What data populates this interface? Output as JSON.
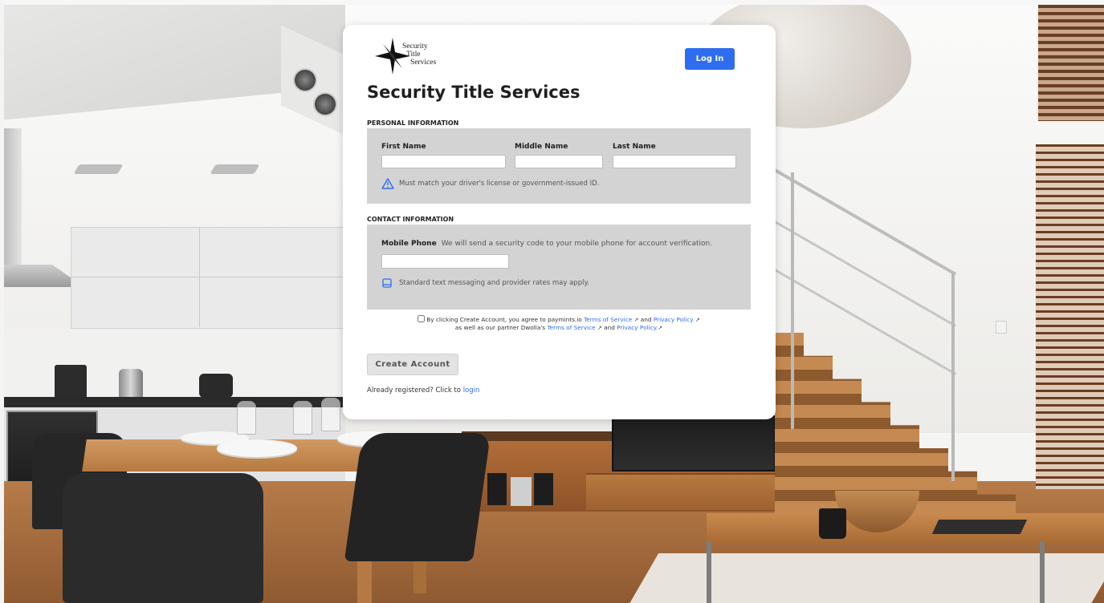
{
  "brand": {
    "logo_lines": [
      "Security",
      "Title",
      "Services"
    ]
  },
  "header": {
    "login_button": "Log In"
  },
  "page_title": "Security Title Services",
  "personal": {
    "section_label": "PERSONAL INFORMATION",
    "first_name_label": "First Name",
    "middle_name_label": "Middle Name",
    "last_name_label": "Last Name",
    "first_name_value": "",
    "middle_name_value": "",
    "last_name_value": "",
    "id_note": "Must match your driver's license or government-issued ID."
  },
  "contact": {
    "section_label": "CONTACT INFORMATION",
    "mobile_label": "Mobile Phone",
    "mobile_hint": "We will send a security code to your mobile phone for account verification.",
    "mobile_value": "",
    "rates_note": "Standard text messaging and provider rates may apply."
  },
  "agreement": {
    "checked": false,
    "line1_prefix": "By clicking Create Account, you agree to paymints.io",
    "terms_link": "Terms of Service",
    "and": "and",
    "privacy_link": "Privacy Policy",
    "line2_prefix": "as well as our partner Dwolla's",
    "dwolla_terms_link": "Terms of Service",
    "and2": "and",
    "dwolla_privacy_link": "Privacy Policy."
  },
  "actions": {
    "create_account": "Create Account",
    "already_text": "Already registered? Click to",
    "login_link": "login"
  },
  "colors": {
    "accent": "#2f6df0",
    "panel": "#d3d3d3",
    "card": "#ffffff"
  },
  "icons": [
    "warning-triangle-icon",
    "device-icon",
    "external-link-icon",
    "logo-star-icon"
  ]
}
